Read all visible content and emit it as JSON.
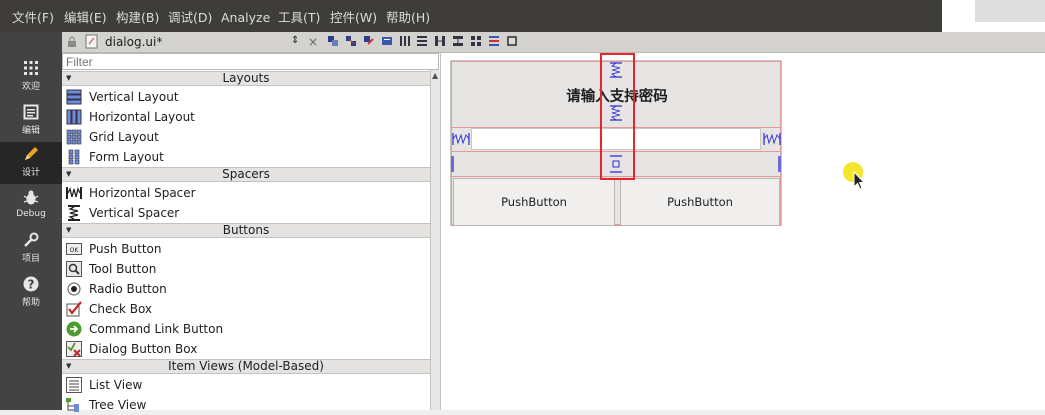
{
  "menubar": {
    "items": [
      "文件(F)",
      "编辑(E)",
      "构建(B)",
      "调试(D)",
      "Analyze",
      "工具(T)",
      "控件(W)",
      "帮助(H)"
    ]
  },
  "modes": [
    {
      "label": "欢迎",
      "icon": "welcome-grid-icon"
    },
    {
      "label": "编辑",
      "icon": "edit-document-icon"
    },
    {
      "label": "设计",
      "icon": "design-pencil-icon"
    },
    {
      "label": "Debug",
      "icon": "debug-bug-icon"
    },
    {
      "label": "项目",
      "icon": "project-wrench-icon"
    },
    {
      "label": "帮助",
      "icon": "help-question-icon"
    }
  ],
  "toolbar": {
    "file_name": "dialog.ui*",
    "selector_arrows": "⇕",
    "close_glyph": "×"
  },
  "widgetbox": {
    "filter_placeholder": "Filter",
    "categories": [
      {
        "label": "Layouts",
        "items": [
          "Vertical Layout",
          "Horizontal Layout",
          "Grid Layout",
          "Form Layout"
        ]
      },
      {
        "label": "Spacers",
        "items": [
          "Horizontal Spacer",
          "Vertical Spacer"
        ]
      },
      {
        "label": "Buttons",
        "items": [
          "Push Button",
          "Tool Button",
          "Radio Button",
          "Check Box",
          "Command Link Button",
          "Dialog Button Box"
        ]
      },
      {
        "label": "Item Views (Model-Based)",
        "items": [
          "List View",
          "Tree View"
        ]
      }
    ]
  },
  "form": {
    "label_text": "请输入支持密码",
    "button_left": "PushButton",
    "button_right": "PushButton"
  },
  "colors": {
    "highlight": "#e8242c",
    "layout_border": "#e49a9a",
    "spacer_blue": "#2b2bd6"
  }
}
